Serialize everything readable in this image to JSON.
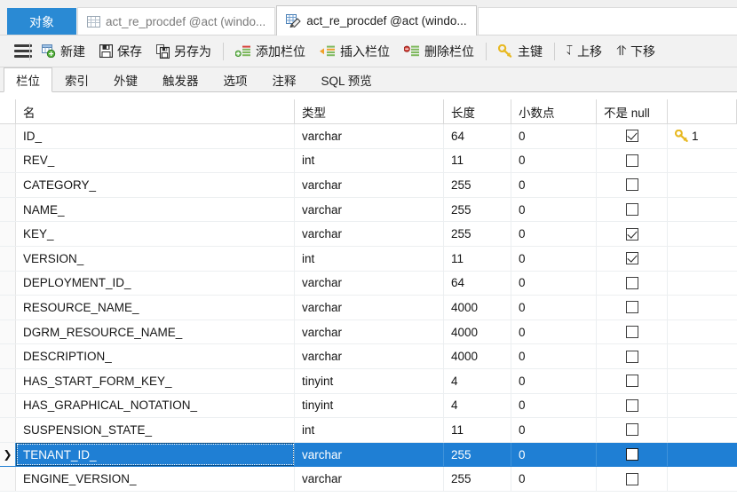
{
  "window_tabs": [
    {
      "label": "对象",
      "kind": "object-browser",
      "state": "highlighted"
    },
    {
      "label": "act_re_procdef @act (windo...",
      "kind": "table-data",
      "state": "inactive"
    },
    {
      "label": "act_re_procdef @act (windo...",
      "kind": "table-designer",
      "state": "active"
    }
  ],
  "toolbar": {
    "menu_icon": "hamburger-icon",
    "items": [
      {
        "label": "新建",
        "icon": "new-table-icon"
      },
      {
        "label": "保存",
        "icon": "save-icon"
      },
      {
        "label": "另存为",
        "icon": "save-as-icon"
      },
      {
        "label": "添加栏位",
        "icon": "add-field-icon"
      },
      {
        "label": "插入栏位",
        "icon": "insert-field-icon"
      },
      {
        "label": "删除栏位",
        "icon": "delete-field-icon"
      },
      {
        "label": "主键",
        "icon": "primary-key-icon"
      },
      {
        "label": "上移",
        "icon": "arrow-up-icon"
      },
      {
        "label": "下移",
        "icon": "arrow-down-icon"
      }
    ]
  },
  "sub_tabs": [
    {
      "label": "栏位",
      "active": true
    },
    {
      "label": "索引",
      "active": false
    },
    {
      "label": "外键",
      "active": false
    },
    {
      "label": "触发器",
      "active": false
    },
    {
      "label": "选项",
      "active": false
    },
    {
      "label": "注释",
      "active": false
    },
    {
      "label": "SQL 预览",
      "active": false
    }
  ],
  "grid": {
    "columns": [
      "名",
      "类型",
      "长度",
      "小数点",
      "不是 null",
      ""
    ],
    "selected_row_index": 13,
    "rows": [
      {
        "name": "ID_",
        "type": "varchar",
        "length": "64",
        "decimals": "0",
        "not_null": true,
        "key": "1"
      },
      {
        "name": "REV_",
        "type": "int",
        "length": "11",
        "decimals": "0",
        "not_null": false,
        "key": ""
      },
      {
        "name": "CATEGORY_",
        "type": "varchar",
        "length": "255",
        "decimals": "0",
        "not_null": false,
        "key": ""
      },
      {
        "name": "NAME_",
        "type": "varchar",
        "length": "255",
        "decimals": "0",
        "not_null": false,
        "key": ""
      },
      {
        "name": "KEY_",
        "type": "varchar",
        "length": "255",
        "decimals": "0",
        "not_null": true,
        "key": ""
      },
      {
        "name": "VERSION_",
        "type": "int",
        "length": "11",
        "decimals": "0",
        "not_null": true,
        "key": ""
      },
      {
        "name": "DEPLOYMENT_ID_",
        "type": "varchar",
        "length": "64",
        "decimals": "0",
        "not_null": false,
        "key": ""
      },
      {
        "name": "RESOURCE_NAME_",
        "type": "varchar",
        "length": "4000",
        "decimals": "0",
        "not_null": false,
        "key": ""
      },
      {
        "name": "DGRM_RESOURCE_NAME_",
        "type": "varchar",
        "length": "4000",
        "decimals": "0",
        "not_null": false,
        "key": ""
      },
      {
        "name": "DESCRIPTION_",
        "type": "varchar",
        "length": "4000",
        "decimals": "0",
        "not_null": false,
        "key": ""
      },
      {
        "name": "HAS_START_FORM_KEY_",
        "type": "tinyint",
        "length": "4",
        "decimals": "0",
        "not_null": false,
        "key": ""
      },
      {
        "name": "HAS_GRAPHICAL_NOTATION_",
        "type": "tinyint",
        "length": "4",
        "decimals": "0",
        "not_null": false,
        "key": ""
      },
      {
        "name": "SUSPENSION_STATE_",
        "type": "int",
        "length": "11",
        "decimals": "0",
        "not_null": false,
        "key": ""
      },
      {
        "name": "TENANT_ID_",
        "type": "varchar",
        "length": "255",
        "decimals": "0",
        "not_null": false,
        "key": ""
      },
      {
        "name": "ENGINE_VERSION_",
        "type": "varchar",
        "length": "255",
        "decimals": "0",
        "not_null": false,
        "key": ""
      }
    ]
  },
  "colors": {
    "accent": "#2a8ad4",
    "selection": "#1f7fd4",
    "toolbar_bg": "#f2f2f2",
    "key_gold": "#e8b923"
  }
}
